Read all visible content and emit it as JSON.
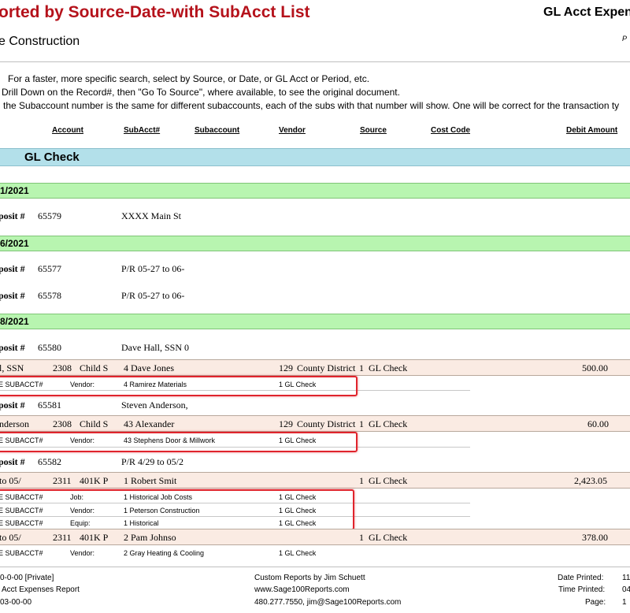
{
  "header": {
    "title": "orted by Source-Date-with SubAcct List",
    "title_right": "GL Acct Expen",
    "company": "e Construction",
    "page_marker": "P"
  },
  "notes": [
    "For a faster, more specific search, select by Source, or Date, or GL Acct or Period, etc.",
    "Drill Down on the Record#, then \"Go To Source\", where available, to see the original document.",
    "the Subaccount number is the same for different subaccounts, each of the subs with that number will show. One will be correct for the transaction ty"
  ],
  "columns": {
    "account": "Account",
    "subacct_no": "SubAcct#",
    "subaccount": "Subaccount",
    "vendor": "Vendor",
    "source": "Source",
    "cost_code": "Cost Code",
    "debit_amount": "Debit Amount"
  },
  "source_group": "GL Check",
  "dates": [
    "1/2021",
    "6/2021",
    "8/2021"
  ],
  "deposits": [
    {
      "label": "posit #",
      "number": "65579",
      "desc": "XXXX Main St"
    },
    {
      "label": "posit #",
      "number": "65577",
      "desc": "P/R 05-27 to 06-"
    },
    {
      "label": "posit #",
      "number": "65578",
      "desc": "P/R 05-27 to 06-"
    },
    {
      "label": "posit #",
      "number": "65580",
      "desc": "Dave Hall, SSN 0"
    },
    {
      "label": "posit #",
      "number": "65581",
      "desc": "Steven Anderson,"
    },
    {
      "label": "posit #",
      "number": "65582",
      "desc": "P/R 4/29 to 05/2"
    }
  ],
  "detail_rows": [
    {
      "c1": "l, SSN",
      "c2": "2308",
      "c3": "Child S",
      "c4": "4 Dave Jones",
      "c5": "129",
      "c6": "County District",
      "c7": "1",
      "c8": "GL Check",
      "amount": "500.00"
    },
    {
      "c1": "nderson",
      "c2": "2308",
      "c3": "Child S",
      "c4": "43 Alexander",
      "c5": "129",
      "c6": "County District",
      "c7": "1",
      "c8": "GL Check",
      "amount": "60.00"
    },
    {
      "c1": "to 05/",
      "c2": "2311",
      "c3": "401K P",
      "c4": "1 Robert Smit",
      "c5": "",
      "c6": "",
      "c7": "1",
      "c8": "GL Check",
      "amount": "2,423.05"
    },
    {
      "c1": "to 05/",
      "c2": "2311",
      "c3": "401K P",
      "c4": "2 Pam Johnso",
      "c5": "",
      "c6": "",
      "c7": "1",
      "c8": "GL Check",
      "amount": "378.00"
    }
  ],
  "sub_rows": [
    {
      "label": "E SUBACCT#",
      "kind": "Vendor:",
      "name": "4 Ramirez Materials",
      "source": "1 GL Check"
    },
    {
      "label": "E SUBACCT#",
      "kind": "Vendor:",
      "name": "43 Stephens Door & Millwork",
      "source": "1 GL Check"
    },
    {
      "label": "E SUBACCT#",
      "kind": "Job:",
      "name": "1 Historical Job Costs",
      "source": "1 GL Check"
    },
    {
      "label": "E SUBACCT#",
      "kind": "Vendor:",
      "name": "1 Peterson Construction",
      "source": "1 GL Check"
    },
    {
      "label": "E SUBACCT#",
      "kind": "Equip:",
      "name": "1 Historical",
      "source": "1 GL Check"
    },
    {
      "label": "E SUBACCT#",
      "kind": "Vendor:",
      "name": "2 Gray Heating & Cooling",
      "source": "1 GL Check"
    }
  ],
  "footer": {
    "left": [
      "0-0-00 [Private]",
      "Acct Expenses Report",
      "03-00-00"
    ],
    "center": [
      "Custom Reports by Jim Schuett",
      "www.Sage100Reports.com",
      "480.277.7550, jim@Sage100Reports.com"
    ],
    "right_labels": [
      "Date Printed:",
      "Time Printed:",
      "Page:"
    ],
    "right_values": [
      "11",
      "04",
      "1"
    ]
  }
}
